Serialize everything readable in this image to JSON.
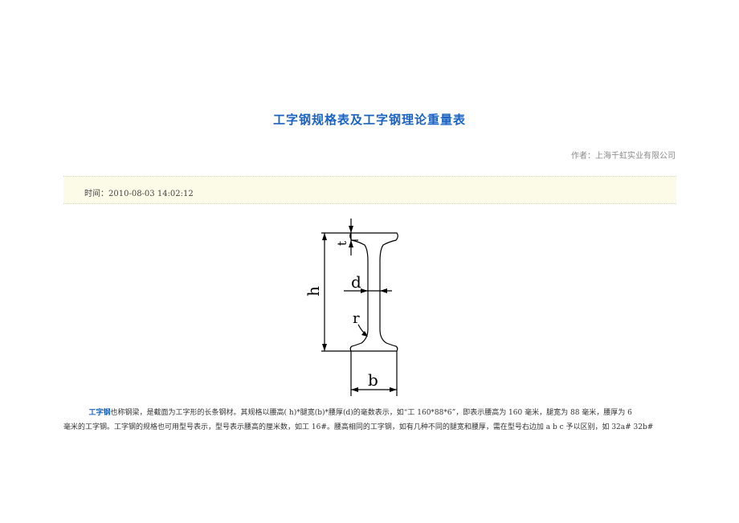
{
  "article": {
    "title": "工字钢规格表及工字钢理论重量表",
    "author": "作者：上海千虹实业有限公司",
    "time": "时间：2010-08-03 14:02:12"
  },
  "diagram": {
    "labels": {
      "t": "t",
      "h": "h",
      "d": "d",
      "r": "r",
      "b": "b"
    }
  },
  "body": {
    "keyword": "工字钢",
    "line1_rest": "也称钢梁，是截面为工字形的长条钢材。其规格以腰高( h)*腿宽(b)*腰厚(d)的毫数表示，如“工 160*88*6”，即表示腰高为 160 毫米，腿宽为 88 毫米，腰厚为 6",
    "line2": "毫米的工字钢。工字钢的规格也可用型号表示，型号表示腰高的厘米数，如工 16#。腰高相同的工字钢，如有几种不同的腿宽和腰厚，需在型号右边加 a b c 予以区别，如 32a# 32b#"
  }
}
